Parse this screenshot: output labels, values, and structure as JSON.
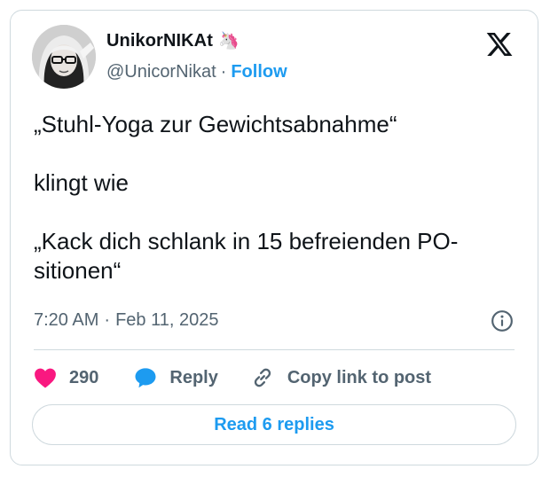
{
  "author": {
    "display_name": "UnikorNIKAt",
    "name_emoji": "🦄",
    "handle": "@UnicorNikat",
    "separator": "·",
    "follow_label": "Follow",
    "avatar_icon": "profile-photo"
  },
  "tweet": {
    "text": "„Stuhl-Yoga zur Gewichtsabnahme“\n\nklingt wie\n\n„Kack dich schlank in 15 befreienden PO-\nsitionen“",
    "time": "7:20 AM",
    "separator": "·",
    "date": "Feb 11, 2025"
  },
  "actions": {
    "like_count": "290",
    "reply_label": "Reply",
    "copy_label": "Copy link to post"
  },
  "read_replies_label": "Read 6 replies",
  "colors": {
    "accent": "#1d9bf0",
    "like": "#f91880",
    "text": "#0f1419",
    "muted": "#536471",
    "border": "#cfd9de"
  },
  "icons": {
    "brand": "x-logo-icon",
    "info": "info-icon",
    "like": "heart-icon",
    "reply": "speech-bubble-icon",
    "copy": "link-icon"
  }
}
